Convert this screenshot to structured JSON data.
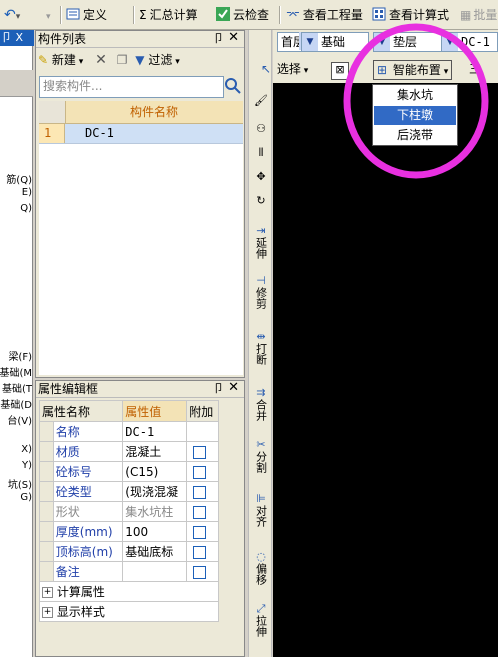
{
  "toolbar": {
    "undo_label": "",
    "define_label": "定义",
    "sum_label": "汇总计算",
    "cloud_label": "云检查",
    "view_quantity_label": "查看工程量",
    "view_formula_label": "查看计算式",
    "batch_label": "批量"
  },
  "left_strip": {
    "header_label": "卩 X",
    "items": [
      "筋(Q)",
      "E)",
      "Q)",
      "梁(F)",
      "基础(M",
      "基础(T",
      "基础(D",
      "台(V)",
      "X)",
      "Y)",
      "坑(S)",
      "G)"
    ]
  },
  "component_list": {
    "title": "构件列表",
    "new_label": "新建",
    "filter_label": "过滤",
    "search_placeholder": "搜索构件...",
    "column_header": "构件名称",
    "rows": [
      {
        "index": "1",
        "name": "DC-1"
      }
    ]
  },
  "property_editor": {
    "title": "属性编辑框",
    "header": {
      "name": "属性名称",
      "value": "属性值",
      "extra": "附加"
    },
    "rows": [
      {
        "name": "名称",
        "value": "DC-1"
      },
      {
        "name": "材质",
        "value": "混凝土"
      },
      {
        "name": "砼标号",
        "value": "(C15)"
      },
      {
        "name": "砼类型",
        "value": "(现浇混凝"
      },
      {
        "name": "形状",
        "value": "集水坑柱"
      },
      {
        "name": "厚度(mm)",
        "value": "100"
      },
      {
        "name": "顶标高(m)",
        "value": "基础底标"
      },
      {
        "name": "备注",
        "value": ""
      }
    ],
    "groups": [
      "计算属性",
      "显示样式"
    ]
  },
  "vertical_toolbar": {
    "items": [
      "延伸",
      "修剪",
      "打断",
      "合并",
      "分割",
      "对齐",
      "偏移",
      "拉伸"
    ]
  },
  "selector_bar": {
    "floor": "首层",
    "category": "基础",
    "type": "垫层",
    "component": "DC-1"
  },
  "action_bar": {
    "select_label": "选择",
    "smart_layout_label": "智能布置",
    "trailing_label": "三"
  },
  "dropdown": {
    "items": [
      "集水坑",
      "下柱墩",
      "后浇带"
    ],
    "selected_index": 1
  },
  "colors": {
    "highlight_ring": "#e830e0",
    "selection": "#316ac5",
    "header_orange": "#c06000"
  }
}
